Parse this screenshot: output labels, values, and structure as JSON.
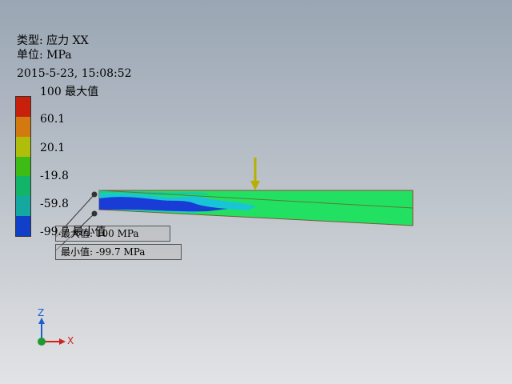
{
  "header": {
    "type_line": "类型: 应力 XX",
    "unit_line": "单位: MPa",
    "timestamp": "2015-5-23, 15:08:52"
  },
  "legend": {
    "ticks": [
      {
        "value": "100",
        "suffix": " 最大值"
      },
      {
        "value": "60.1"
      },
      {
        "value": "20.1"
      },
      {
        "value": "-19.8"
      },
      {
        "value": "-59.8"
      },
      {
        "value": "-99.7",
        "suffix": " 最小值"
      }
    ],
    "colors": [
      "#c8200a",
      "#d27a10",
      "#aebe0a",
      "#3cbc14",
      "#12b46a",
      "#14a8a0",
      "#1040c8"
    ]
  },
  "callouts": {
    "max": "最大值: 100 MPa",
    "min": "最小值: -99.7 MPa"
  },
  "triad": {
    "z": "Z",
    "x": "X"
  },
  "colors": {
    "beam_green": "#22e062",
    "beam_blue": "#1a3cd6",
    "beam_cyan": "#19c4d6",
    "load_arrow": "#b6b000",
    "triad_axis": "#1a5fd0",
    "triad_x": "#d02020",
    "origin": "#1f9a32"
  }
}
